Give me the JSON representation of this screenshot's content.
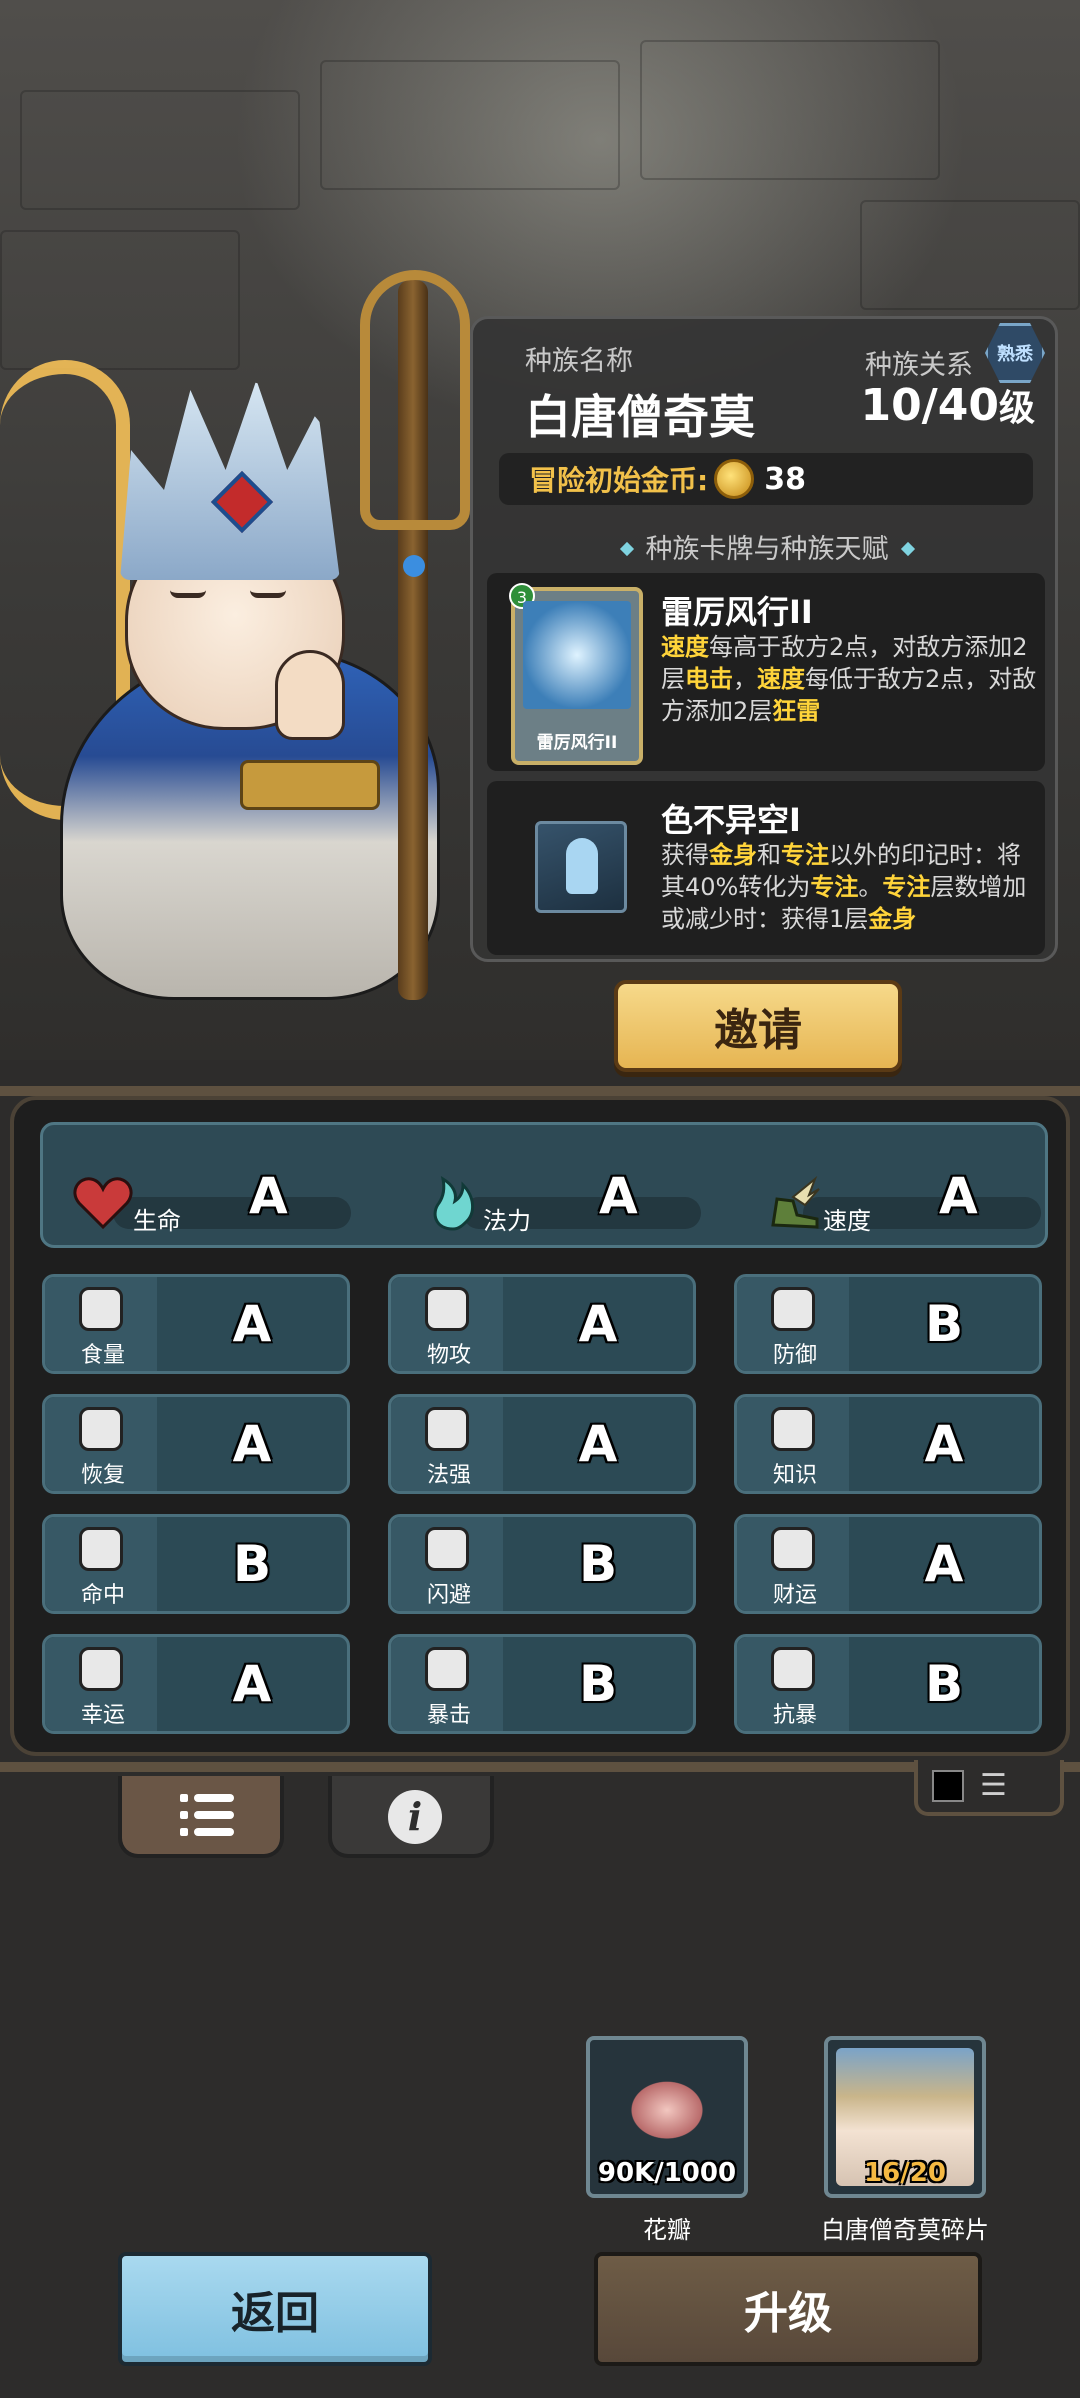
{
  "race": {
    "name_label": "种族名称",
    "name": "白唐僧奇莫",
    "relation_label": "种族关系",
    "relation_badge": "熟悉",
    "level": "10/40",
    "level_unit": "级",
    "coin_label": "冒险初始金币:",
    "coin_value": "38",
    "section_title": "种族卡牌与种族天赋"
  },
  "card_skill": {
    "title": "雷厉风行II",
    "card_name": "雷厉风行II",
    "card_cost": "3",
    "desc": [
      "速度",
      "每高于敌方2点，对敌方添加2层",
      "电击",
      "，",
      "速度",
      "每低于敌方2点，对敌方添加2层",
      "狂雷"
    ]
  },
  "talent": {
    "title": "色不异空I",
    "desc": [
      "获得",
      "金身",
      "和",
      "专注",
      "以外的印记时：将其40%转化为",
      "专注",
      "。",
      "专注",
      "层数增加或减少时：获得1层",
      "金身"
    ]
  },
  "invite_label": "邀请",
  "main_stats": [
    {
      "label": "生命",
      "grade": "A",
      "icon": "heart-icon",
      "color": "#c93a3a"
    },
    {
      "label": "法力",
      "grade": "A",
      "icon": "mana-flame-icon",
      "color": "#6fd6d0"
    },
    {
      "label": "速度",
      "grade": "A",
      "icon": "winged-boot-icon",
      "color": "#8cbf5a"
    }
  ],
  "stats": [
    {
      "label": "食量",
      "grade": "A",
      "icon": "stomach-icon"
    },
    {
      "label": "物攻",
      "grade": "A",
      "icon": "sword-icon"
    },
    {
      "label": "防御",
      "grade": "B",
      "icon": "armor-icon"
    },
    {
      "label": "恢复",
      "grade": "A",
      "icon": "heart-plus-icon"
    },
    {
      "label": "法强",
      "grade": "A",
      "icon": "staff-icon"
    },
    {
      "label": "知识",
      "grade": "A",
      "icon": "book-icon"
    },
    {
      "label": "命中",
      "grade": "B",
      "icon": "target-icon"
    },
    {
      "label": "闪避",
      "grade": "B",
      "icon": "dodge-arrow-icon"
    },
    {
      "label": "财运",
      "grade": "A",
      "icon": "coin-icon"
    },
    {
      "label": "幸运",
      "grade": "A",
      "icon": "clover-icon"
    },
    {
      "label": "暴击",
      "grade": "B",
      "icon": "crit-dagger-icon"
    },
    {
      "label": "抗暴",
      "grade": "B",
      "icon": "shield-crest-icon"
    }
  ],
  "materials": [
    {
      "name": "花瓣",
      "count": "90K/1000",
      "icon": "petal-icon"
    },
    {
      "name": "白唐僧奇莫碎片",
      "count": "16/20",
      "icon": "shard-portrait-icon"
    }
  ],
  "buttons": {
    "back": "返回",
    "upgrade": "升级"
  }
}
